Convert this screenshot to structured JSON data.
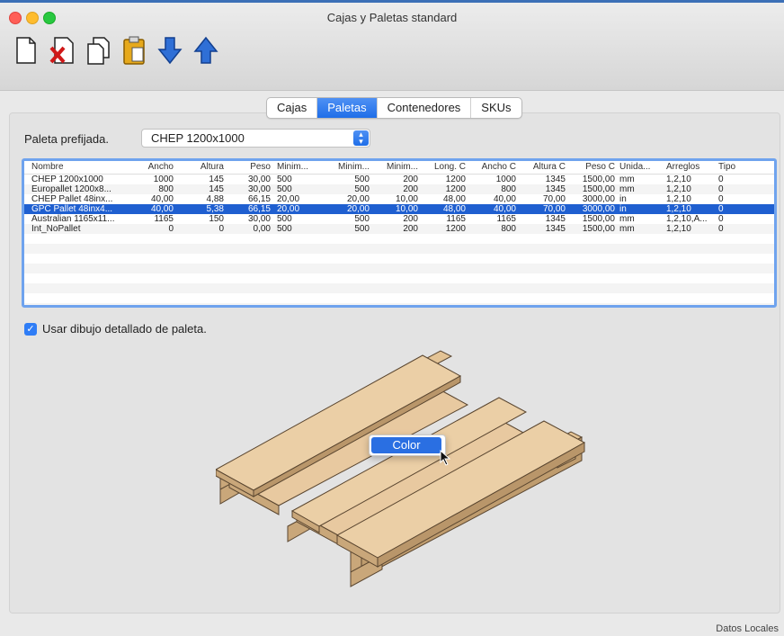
{
  "window": {
    "title": "Cajas y Paletas standard"
  },
  "toolbar": [
    {
      "icon": "new-document-icon"
    },
    {
      "icon": "delete-document-icon"
    },
    {
      "icon": "duplicate-document-icon"
    },
    {
      "icon": "clipboard-icon"
    },
    {
      "icon": "import-arrow-icon"
    },
    {
      "icon": "export-arrow-icon"
    }
  ],
  "tabs": [
    {
      "label": "Cajas",
      "active": false
    },
    {
      "label": "Paletas",
      "active": true
    },
    {
      "label": "Contenedores",
      "active": false
    },
    {
      "label": "SKUs",
      "active": false
    }
  ],
  "preset": {
    "label": "Paleta prefijada.",
    "value": "CHEP 1200x1000"
  },
  "table": {
    "columns": [
      "Nombre",
      "Ancho",
      "Altura",
      "Peso",
      "Minim...",
      "Minim...",
      "Minim...",
      "Long. C",
      "Ancho C",
      "Altura C",
      "Peso C",
      "Unida...",
      "Arreglos",
      "Tipo"
    ],
    "rows": [
      [
        "CHEP 1200x1000",
        "1000",
        "145",
        "30,00",
        "500",
        "500",
        "200",
        "1200",
        "1000",
        "1345",
        "1500,00",
        "mm",
        "1,2,10",
        "0"
      ],
      [
        "Europallet 1200x8...",
        "800",
        "145",
        "30,00",
        "500",
        "500",
        "200",
        "1200",
        "800",
        "1345",
        "1500,00",
        "mm",
        "1,2,10",
        "0"
      ],
      [
        "CHEP Pallet 48inx...",
        "40,00",
        "4,88",
        "66,15",
        "20,00",
        "20,00",
        "10,00",
        "48,00",
        "40,00",
        "70,00",
        "3000,00",
        "in",
        "1,2,10",
        "0"
      ],
      [
        "GPC Pallet 48inx4...",
        "40,00",
        "5,38",
        "66,15",
        "20,00",
        "20,00",
        "10,00",
        "48,00",
        "40,00",
        "70,00",
        "3000,00",
        "in",
        "1,2,10",
        "0"
      ],
      [
        "Australian 1165x11...",
        "1165",
        "150",
        "30,00",
        "500",
        "500",
        "200",
        "1165",
        "1165",
        "1345",
        "1500,00",
        "mm",
        "1,2,10,A...",
        "0"
      ],
      [
        "Int_NoPallet",
        "0",
        "0",
        "0,00",
        "500",
        "500",
        "200",
        "1200",
        "800",
        "1345",
        "1500,00",
        "mm",
        "1,2,10",
        "0"
      ]
    ],
    "selected_row": 3
  },
  "checkbox": {
    "label": "Usar dibujo detallado de paleta.",
    "checked": true
  },
  "context_menu": {
    "item": "Color"
  },
  "status": "Datos Locales",
  "colors": {
    "accent": "#1f6ee8",
    "wood": "#e8c9a0",
    "wood_side": "#c9a77a"
  }
}
